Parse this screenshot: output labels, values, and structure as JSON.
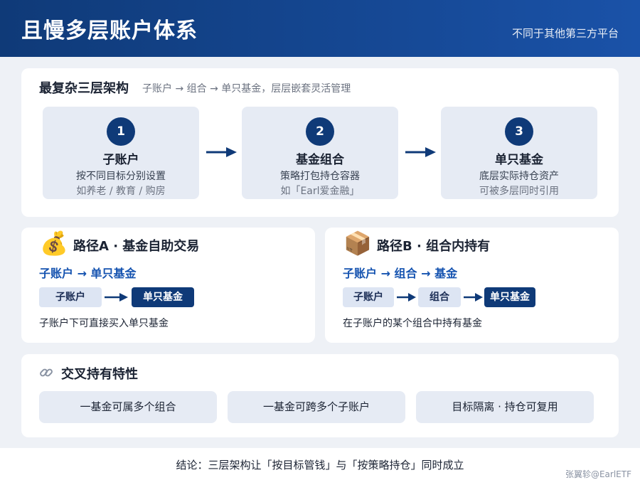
{
  "header": {
    "title": "且慢多层账户体系",
    "subtitle": "不同于其他第三方平台"
  },
  "architecture": {
    "title": "最复杂三层架构",
    "subtitle": "子账户 → 组合 → 单只基金，层层嵌套灵活管理",
    "layers": [
      {
        "num": "1",
        "name": "子账户",
        "desc": "按不同目标分别设置",
        "note": "如养老 / 教育 / 购房"
      },
      {
        "num": "2",
        "name": "基金组合",
        "desc": "策略打包持仓容器",
        "note": "如「Earl爱金融」"
      },
      {
        "num": "3",
        "name": "单只基金",
        "desc": "底层实际持仓资产",
        "note": "可被多层同时引用"
      }
    ]
  },
  "routes": [
    {
      "icon": "money-bag-icon",
      "emoji": "💰",
      "title": "路径A · 基金自助交易",
      "chain": "子账户 → 单只基金",
      "steps": [
        "子账户",
        "单只基金"
      ],
      "note": "子账户下可直接买入单只基金"
    },
    {
      "icon": "package-icon",
      "emoji": "📦",
      "title": "路径B · 组合内持有",
      "chain": "子账户 → 组合 → 基金",
      "steps": [
        "子账户",
        "组合",
        "单只基金"
      ],
      "note": "在子账户的某个组合中持有基金"
    }
  ],
  "cross": {
    "icon": "link-icon",
    "title": "交叉持有特性",
    "features": [
      "一基金可属多个组合",
      "一基金可跨多个子账户",
      "目标隔离 · 持仓可复用"
    ]
  },
  "footer": {
    "conclusion": "结论：三层架构让「按目标管钱」与「按策略持仓」同时成立",
    "author": "张翼轸@EarlETF"
  },
  "colors": {
    "primary": "#0f3a78",
    "accent": "#1553b0",
    "panel": "#e6ebf4",
    "background": "#eef1f6"
  }
}
